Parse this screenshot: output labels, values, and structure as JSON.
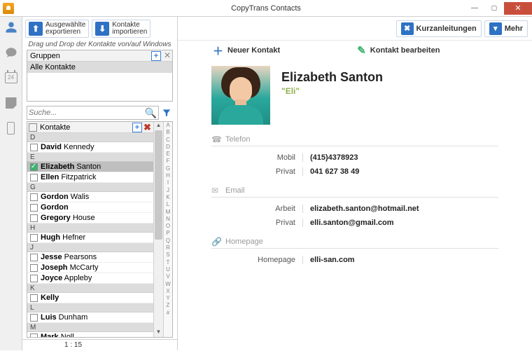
{
  "window": {
    "title": "CopyTrans Contacts"
  },
  "rail": {
    "calendar_day": "24"
  },
  "toolbar": {
    "export_l1": "Ausgewählte",
    "export_l2": "exportieren",
    "import_l1": "Kontakte",
    "import_l2": "importieren",
    "quickstart": "Kurzanleitungen",
    "more": "Mehr"
  },
  "actions": {
    "new_contact": "Neuer Kontakt",
    "edit_contact": "Kontakt bearbeiten"
  },
  "dragdrop_hint": "Drag und Drop der Kontakte von/auf Windows",
  "groups": {
    "header": "Gruppen",
    "rows": [
      {
        "label": "Alle Kontakte"
      }
    ]
  },
  "search": {
    "placeholder": "Suche..."
  },
  "contacts": {
    "header": "Kontakte",
    "sections": [
      {
        "letter": "D",
        "rows": [
          {
            "first": "David",
            "last": "Kennedy",
            "sel": false
          }
        ]
      },
      {
        "letter": "E",
        "rows": [
          {
            "first": "Elizabeth",
            "last": "Santon",
            "sel": true
          },
          {
            "first": "Ellen",
            "last": "Fitzpatrick",
            "sel": false
          }
        ]
      },
      {
        "letter": "G",
        "rows": [
          {
            "first": "Gordon",
            "last": "Walis",
            "sel": false
          },
          {
            "first": "Gordon",
            "last": "",
            "sel": false
          },
          {
            "first": "Gregory",
            "last": "House",
            "sel": false
          }
        ]
      },
      {
        "letter": "H",
        "rows": [
          {
            "first": "Hugh",
            "last": "Hefner",
            "sel": false
          }
        ]
      },
      {
        "letter": "J",
        "rows": [
          {
            "first": "Jesse",
            "last": "Pearsons",
            "sel": false
          },
          {
            "first": "Joseph",
            "last": "McCarty",
            "sel": false
          },
          {
            "first": "Joyce",
            "last": "Appleby",
            "sel": false
          }
        ]
      },
      {
        "letter": "K",
        "rows": [
          {
            "first": "Kelly",
            "last": "",
            "sel": false
          }
        ]
      },
      {
        "letter": "L",
        "rows": [
          {
            "first": "Luis",
            "last": "Dunham",
            "sel": false
          }
        ]
      },
      {
        "letter": "M",
        "rows": [
          {
            "first": "Mark",
            "last": "Noll",
            "sel": false
          }
        ]
      }
    ],
    "alphabet": [
      "A",
      "B",
      "C",
      "D",
      "E",
      "F",
      "G",
      "H",
      "I",
      "J",
      "K",
      "L",
      "M",
      "N",
      "O",
      "P",
      "Q",
      "R",
      "S",
      "T",
      "U",
      "V",
      "W",
      "X",
      "Y",
      "Z",
      "#"
    ]
  },
  "status": {
    "position": "1 : 15"
  },
  "card": {
    "fullname": "Elizabeth Santon",
    "nickname": "\"Eli\"",
    "sections": {
      "phone": {
        "title": "Telefon",
        "rows": [
          {
            "label": "Mobil",
            "value": "(415)4378923"
          },
          {
            "label": "Privat",
            "value": "041 627 38 49"
          }
        ]
      },
      "email": {
        "title": "Email",
        "rows": [
          {
            "label": "Arbeit",
            "value": "elizabeth.santon@hotmail.net"
          },
          {
            "label": "Privat",
            "value": "elli.santon@gmail.com"
          }
        ]
      },
      "homepage": {
        "title": "Homepage",
        "rows": [
          {
            "label": "Homepage",
            "value": "elli-san.com"
          }
        ]
      }
    }
  }
}
